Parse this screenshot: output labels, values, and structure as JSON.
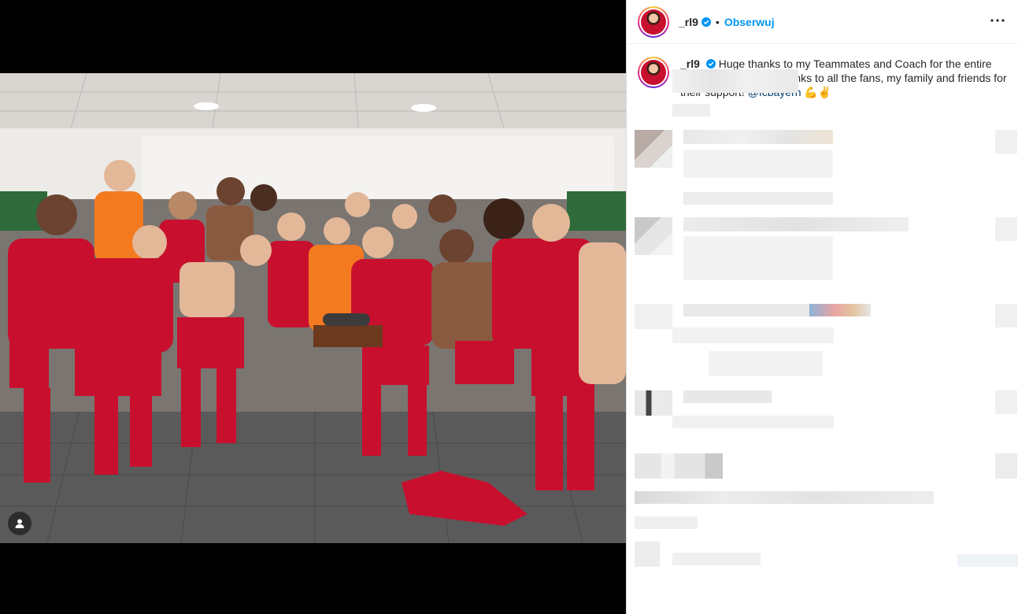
{
  "post": {
    "username": "_rl9",
    "follow_label": "Obserwuj",
    "dot": "•",
    "more_label": "•••"
  },
  "caption": {
    "username": "_rl9",
    "text_part1": "Huge thanks to my Teammates and Coach for the entire season! 🙌⚽ Also, thanks to all the fans, my family and friends for their support!",
    "mention": "@fcbayern",
    "emoji_end": "💪✌"
  },
  "colors": {
    "accent": "#0095f6",
    "mention": "#00376b",
    "kit_red": "#c8102e",
    "keeper_orange": "#f47a20"
  },
  "icons": {
    "verified": "verified-badge-icon",
    "more": "more-options-icon",
    "user_tag": "user-tag-icon"
  }
}
